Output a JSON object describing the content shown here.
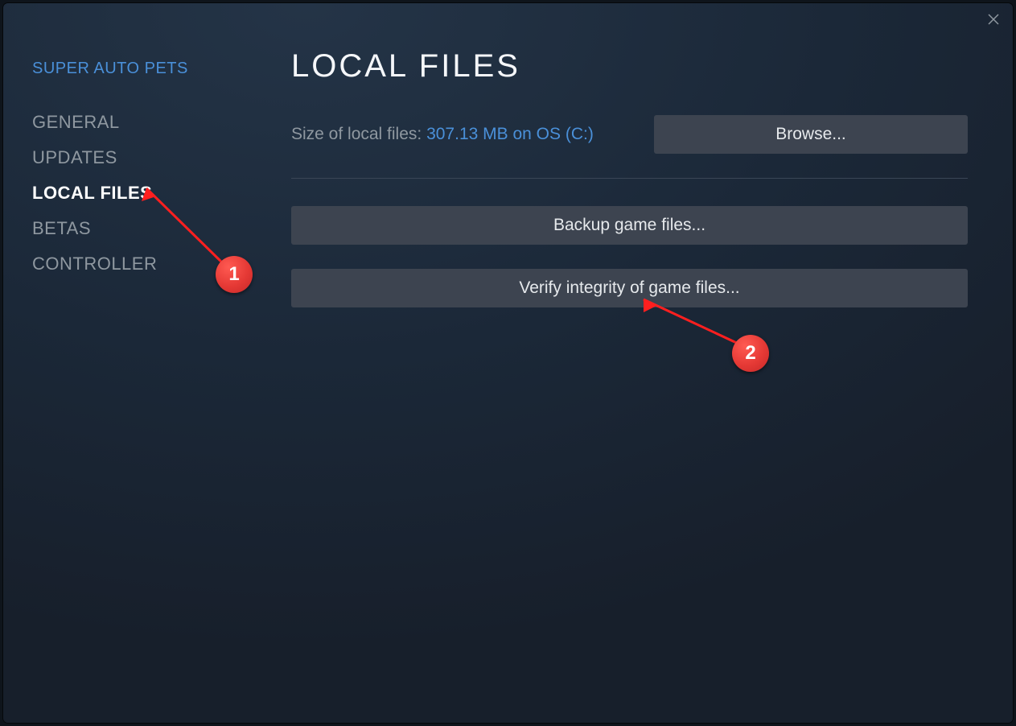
{
  "header": {
    "game_title": "SUPER AUTO PETS"
  },
  "sidebar": {
    "items": [
      {
        "label": "GENERAL",
        "active": false
      },
      {
        "label": "UPDATES",
        "active": false
      },
      {
        "label": "LOCAL FILES",
        "active": true
      },
      {
        "label": "BETAS",
        "active": false
      },
      {
        "label": "CONTROLLER",
        "active": false
      }
    ]
  },
  "main": {
    "title": "LOCAL FILES",
    "size_label": "Size of local files: ",
    "size_value": "307.13 MB on OS (C:)",
    "browse_label": "Browse...",
    "backup_label": "Backup game files...",
    "verify_label": "Verify integrity of game files..."
  },
  "annotations": {
    "markers": [
      {
        "n": "1"
      },
      {
        "n": "2"
      }
    ]
  }
}
